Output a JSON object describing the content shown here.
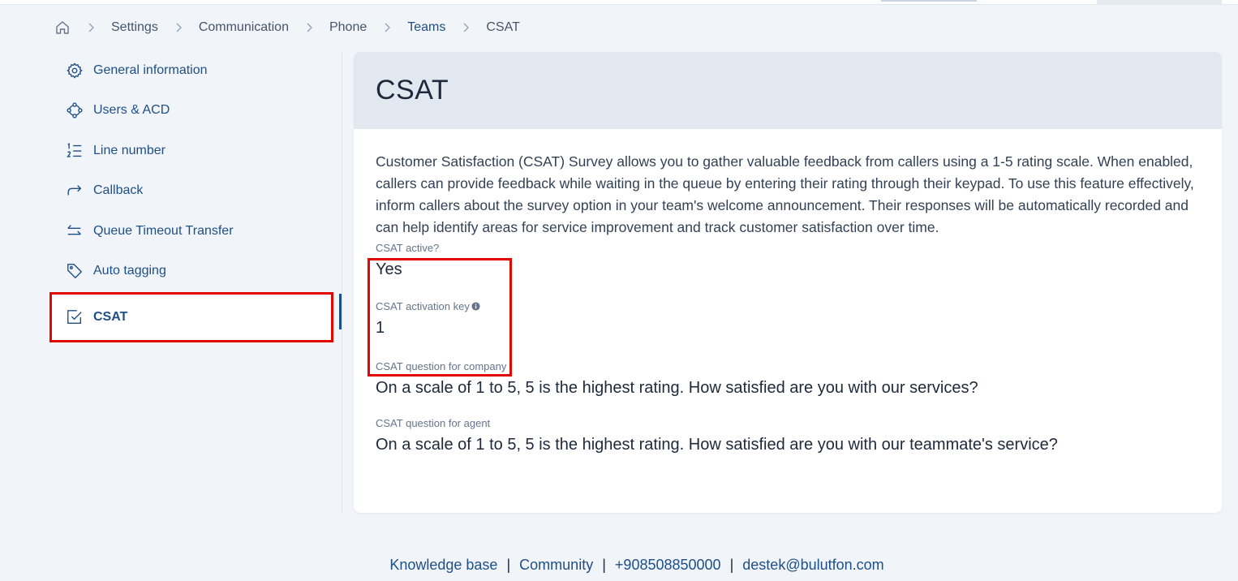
{
  "breadcrumb": {
    "items": [
      {
        "label": "Settings"
      },
      {
        "label": "Communication"
      },
      {
        "label": "Phone"
      },
      {
        "label": "Teams"
      },
      {
        "label": "CSAT"
      }
    ]
  },
  "sidebar": {
    "items": [
      {
        "label": "General information",
        "icon": "gear-icon"
      },
      {
        "label": "Users & ACD",
        "icon": "users-cluster-icon"
      },
      {
        "label": "Line number",
        "icon": "numbered-list-icon"
      },
      {
        "label": "Callback",
        "icon": "redo-arrow-icon"
      },
      {
        "label": "Queue Timeout Transfer",
        "icon": "transfer-arrows-icon"
      },
      {
        "label": "Auto tagging",
        "icon": "tag-icon"
      },
      {
        "label": "CSAT",
        "icon": "checkbox-icon",
        "active": true
      }
    ]
  },
  "main": {
    "title": "CSAT",
    "description": "Customer Satisfaction (CSAT) Survey allows you to gather valuable feedback from callers using a 1-5 rating scale. When enabled, callers can provide feedback while waiting in the queue by entering their rating through their keypad. To use this feature effectively, inform callers about the survey option in your team's welcome announcement. Their responses will be automatically recorded and can help identify areas for service improvement and track customer satisfaction over time.",
    "fields": {
      "active": {
        "label": "CSAT active?",
        "value": "Yes"
      },
      "activation_key": {
        "label": "CSAT activation key",
        "value": "1"
      },
      "company_question": {
        "label": "CSAT question for company",
        "value": "On a scale of 1 to 5, 5 is the highest rating. How satisfied are you with our services?"
      },
      "agent_question": {
        "label": "CSAT question for agent",
        "value": "On a scale of 1 to 5, 5 is the highest rating. How satisfied are you with our teammate's service?"
      }
    }
  },
  "footer": {
    "knowledge_base": "Knowledge base",
    "community": "Community",
    "phone": "+908508850000",
    "email": "destek@bulutfon.com",
    "separator": "|"
  },
  "colors": {
    "accent": "#1e4f86",
    "highlight": "#e10600",
    "background": "#f1f4f9",
    "header_bg": "#e2e8f0"
  }
}
